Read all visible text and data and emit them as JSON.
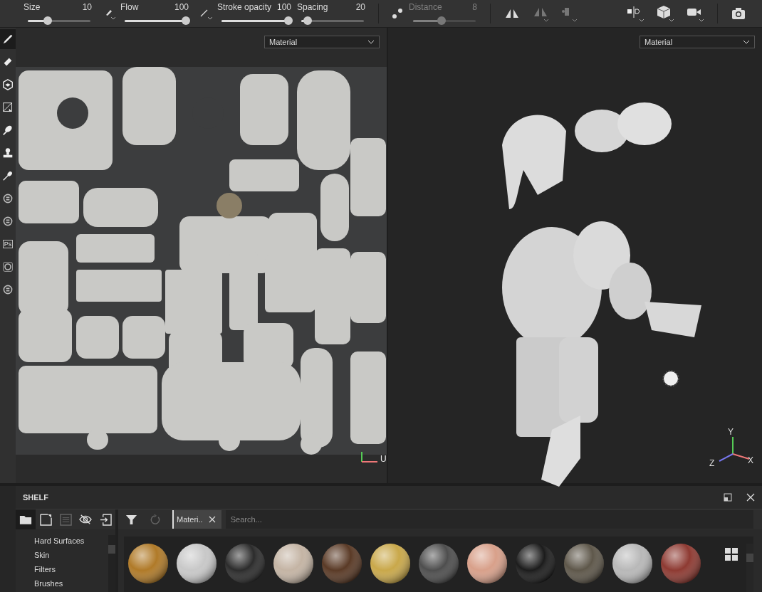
{
  "toolbar": {
    "sliders": [
      {
        "label": "Size",
        "value": "10",
        "level": 0.31,
        "disabled": false
      },
      {
        "label": "Flow",
        "value": "100",
        "level": 1,
        "disabled": false
      },
      {
        "label": "Stroke opacity",
        "value": "100",
        "level": 1,
        "disabled": false
      },
      {
        "label": "Spacing",
        "value": "20",
        "level": 0.08,
        "disabled": false
      },
      {
        "label": "Distance",
        "value": "8",
        "level": 0.45,
        "disabled": true
      }
    ]
  },
  "tools": [
    {
      "kind": "brush",
      "selected": true
    },
    {
      "kind": "eraser",
      "selected": false
    },
    {
      "kind": "projection",
      "selected": false
    },
    {
      "kind": "polyfill",
      "selected": false
    },
    {
      "kind": "smudge",
      "selected": false
    },
    {
      "kind": "clone",
      "selected": false
    },
    {
      "kind": "picker",
      "selected": false
    },
    {
      "kind": "plugin",
      "selected": false
    },
    {
      "kind": "plugin",
      "selected": false
    },
    {
      "kind": "ps",
      "label": "Ps",
      "selected": false
    },
    {
      "kind": "ring",
      "selected": false
    },
    {
      "kind": "plugin",
      "selected": false
    }
  ],
  "view_2d": {
    "dropdown": "Material",
    "axis_u": "U"
  },
  "view_3d": {
    "dropdown": "Material",
    "axes": {
      "y": "Y",
      "x": "X",
      "z": "Z"
    }
  },
  "shelf": {
    "title": "SHELF",
    "buttons": [
      {
        "kind": "folder",
        "selected": true,
        "disabled": false
      },
      {
        "kind": "new",
        "selected": false,
        "disabled": false
      },
      {
        "kind": "save",
        "selected": false,
        "disabled": true
      },
      {
        "kind": "hide",
        "selected": false,
        "disabled": false
      },
      {
        "kind": "import",
        "selected": false,
        "disabled": false
      }
    ],
    "filter_tab": "Materi..",
    "search": {
      "placeholder": "Search..."
    },
    "categories": [
      "Hard Surfaces",
      "Skin",
      "Filters",
      "Brushes"
    ],
    "materials": [
      {
        "color": "#b07a28"
      },
      {
        "color": "#c8c8c8"
      },
      {
        "color": "#2c2c2c"
      },
      {
        "color": "#c4b4a4"
      },
      {
        "color": "#5a3a26"
      },
      {
        "color": "#c9a84a"
      },
      {
        "color": "#4e4e4e"
      },
      {
        "color": "#d8a08a"
      },
      {
        "color": "#1c1c1c"
      },
      {
        "color": "#5e574a"
      },
      {
        "color": "#b8b8b8"
      },
      {
        "color": "#8e3a32"
      }
    ]
  }
}
